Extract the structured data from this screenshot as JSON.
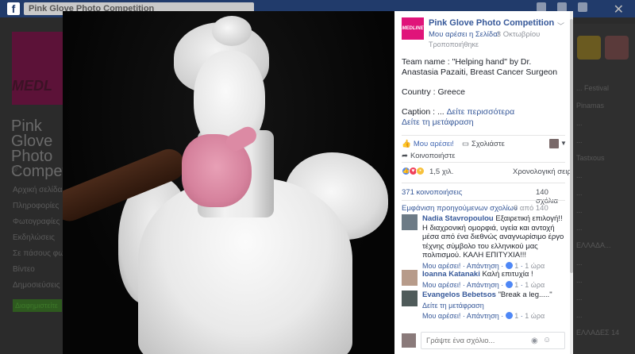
{
  "background": {
    "search_text": "Pink Glove Photo Competition",
    "page_name": "Pink Glove Photo Competit...",
    "menu": [
      "Αρχική σελίδα",
      "Πληροφορίες",
      "Φωτογραφίες",
      "Εκδηλώσεις",
      "Σε πάσους φωτ...",
      "Βίντεο",
      "Δημοσιεύσεις"
    ],
    "promote_label": "Διαφημιστείτε",
    "right_rows": [
      "...",
      "...",
      "...",
      "...",
      "...",
      "... Festival",
      "Pinamas",
      "...",
      "...",
      "Tastxous",
      "...",
      "...",
      "...",
      "...",
      "ΕΛΛΑΔΑ...",
      "...",
      "...",
      "...",
      "...",
      "...",
      "...",
      "ΕΛΛΑΔΕΣ 14"
    ]
  },
  "post": {
    "page_name": "Pink Glove Photo Competition",
    "like_page": "Μου αρέσει η Σελίδα!",
    "date": "· 3 Οκτωβρίου",
    "edited": "Τροποποιήθηκε",
    "team": "Team name : \"Helping hand\" by Dr. Anastasia Pazaiti, Breast Cancer Surgeon",
    "country": "Country : Greece",
    "caption_prefix": "Caption : ...",
    "see_more": "Δείτε περισσότερα",
    "translate": "Δείτε τη μετάφραση"
  },
  "actions": {
    "like": "Μου αρέσει!",
    "comment": "Σχολιάστε",
    "share": "Κοινοποιήστε"
  },
  "stats": {
    "reactions": "1,5 χιλ.",
    "order": "Χρονολογική σειρά ▾",
    "shares": "371 κοινοποιήσεις",
    "comments": "140 σχόλια",
    "prev_comments": "Εμφάνιση προηγούμενων σχολίων",
    "pager": "6 από 140"
  },
  "comments": [
    {
      "name": "Nadia Stavropoulou",
      "text": "Εξαιρετική επιλογή!! Η διαχρονική ομορφιά, υγεία και αντοχή μέσα από ένα διεθνώς αναγνωρίσιμο έργο τέχνης σύμβολο του ελληνικού μας πολιτισμού. ΚΑΛΗ ΕΠΙΤΥΧΙΑ!!!",
      "like": "Μου αρέσει!",
      "reply": "Απάντηση",
      "likes": "1",
      "time": "1 ώρα"
    },
    {
      "name": "Ioanna Katanaki",
      "text": "Καλή επιτυχία !",
      "like": "Μου αρέσει!",
      "reply": "Απάντηση",
      "likes": "1",
      "time": "1 ώρα"
    },
    {
      "name": "Evangelos Bebetsos",
      "text": "\"Break a leg.....\"",
      "translate": "Δείτε τη μετάφραση",
      "like": "Μου αρέσει!",
      "reply": "Απάντηση",
      "likes": "1",
      "time": "1 ώρα"
    }
  ],
  "composer": {
    "placeholder": "Γράψτε ένα σχόλιο..."
  }
}
